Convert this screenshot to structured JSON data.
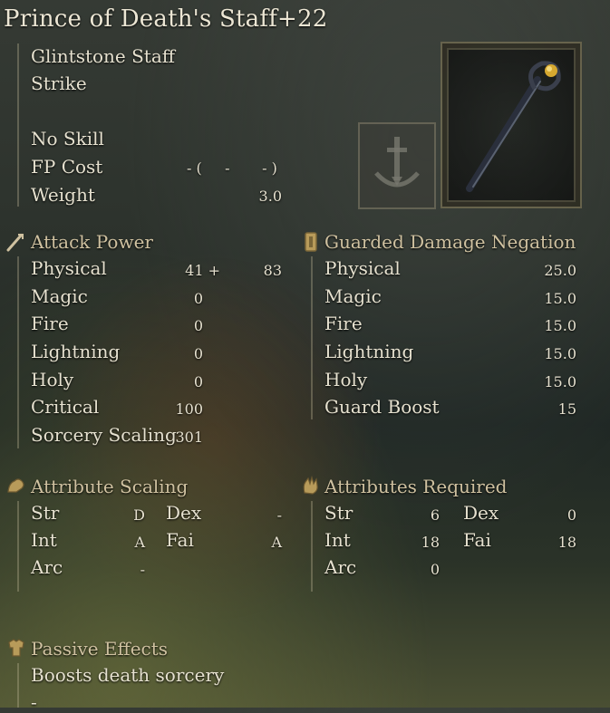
{
  "weapon": {
    "name": "Prince of Death's Staff+22",
    "type": "Glintstone Staff",
    "damage_type": "Strike",
    "skill": "No Skill",
    "fp_label": "FP Cost",
    "fp_value": "- (     -       - )",
    "weight_label": "Weight",
    "weight_value": "3.0"
  },
  "attack_power": {
    "heading": "Attack Power",
    "rows": [
      {
        "label": "Physical",
        "value": "41 +",
        "extra": "83"
      },
      {
        "label": "Magic",
        "value": "0"
      },
      {
        "label": "Fire",
        "value": "0"
      },
      {
        "label": "Lightning",
        "value": "0"
      },
      {
        "label": "Holy",
        "value": "0"
      },
      {
        "label": "Critical",
        "value": "100"
      },
      {
        "label": "Sorcery Scaling",
        "value": "301"
      }
    ]
  },
  "guarded": {
    "heading": "Guarded Damage Negation",
    "rows": [
      {
        "label": "Physical",
        "value": "25.0"
      },
      {
        "label": "Magic",
        "value": "15.0"
      },
      {
        "label": "Fire",
        "value": "15.0"
      },
      {
        "label": "Lightning",
        "value": "15.0"
      },
      {
        "label": "Holy",
        "value": "15.0"
      },
      {
        "label": "Guard Boost",
        "value": "15"
      }
    ]
  },
  "scaling": {
    "heading": "Attribute Scaling",
    "rows": [
      {
        "l1": "Str",
        "v1": "D",
        "l2": "Dex",
        "v2": "-"
      },
      {
        "l1": "Int",
        "v1": "A",
        "l2": "Fai",
        "v2": "A"
      },
      {
        "l1": "Arc",
        "v1": "-"
      }
    ]
  },
  "required": {
    "heading": "Attributes Required",
    "rows": [
      {
        "l1": "Str",
        "v1": "6",
        "l2": "Dex",
        "v2": "0"
      },
      {
        "l1": "Int",
        "v1": "18",
        "l2": "Fai",
        "v2": "18"
      },
      {
        "l1": "Arc",
        "v1": "0"
      }
    ]
  },
  "passive": {
    "heading": "Passive Effects",
    "lines": [
      "Boosts death sorcery",
      "-"
    ]
  },
  "icons": {
    "attack": "sword-icon",
    "guard": "shield-icon",
    "scaling": "arm-icon",
    "required": "hand-icon",
    "passive": "armor-icon",
    "skill": "anchor-sword-icon",
    "weapon": "staff-icon"
  },
  "colors": {
    "text": "#e6e1cf",
    "heading": "#cfc1a0",
    "frame": "#aaa078"
  }
}
